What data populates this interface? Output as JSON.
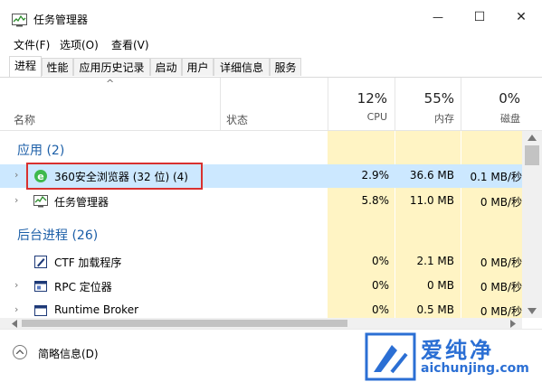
{
  "window": {
    "title": "任务管理器",
    "minimize": "—",
    "maximize": "☐",
    "close": "✕"
  },
  "menu": [
    "文件(F)",
    "选项(O)",
    "查看(V)"
  ],
  "tabs": [
    "进程",
    "性能",
    "应用历史记录",
    "启动",
    "用户",
    "详细信息",
    "服务"
  ],
  "header": {
    "sort_arrow": "^",
    "name": "名称",
    "status": "状态",
    "cpu": {
      "pct": "12%",
      "label": "CPU"
    },
    "memory": {
      "pct": "55%",
      "label": "内存"
    },
    "disk": {
      "pct": "0%",
      "label": "磁盘"
    }
  },
  "groups": {
    "apps": "应用 (2)",
    "background": "后台进程 (26)"
  },
  "rows": [
    {
      "name": "360安全浏览器 (32 位) (4)",
      "cpu": "2.9%",
      "mem": "36.6 MB",
      "disk": "0.1 MB/秒",
      "expand": "›",
      "selected": true
    },
    {
      "name": "任务管理器",
      "cpu": "5.8%",
      "mem": "11.0 MB",
      "disk": "0 MB/秒",
      "expand": "›"
    },
    {
      "name": "CTF 加载程序",
      "cpu": "0%",
      "mem": "2.1 MB",
      "disk": "0 MB/秒",
      "expand": ""
    },
    {
      "name": "RPC 定位器",
      "cpu": "0%",
      "mem": "0 MB",
      "disk": "0 MB/秒",
      "expand": "›"
    },
    {
      "name": "Runtime Broker",
      "cpu": "0%",
      "mem": "0.5 MB",
      "disk": "0 MB/秒",
      "expand": "›"
    }
  ],
  "footer": {
    "label": "简略信息(D)"
  },
  "watermark": {
    "cn": "爱纯净",
    "url": "aichunjing.com"
  },
  "colors": {
    "selected_row": "#cce8ff",
    "metric_bg": "#fff4c4",
    "group_header": "#1c5fa8",
    "highlight": "#d9312f",
    "watermark": "#2b6fd4"
  }
}
